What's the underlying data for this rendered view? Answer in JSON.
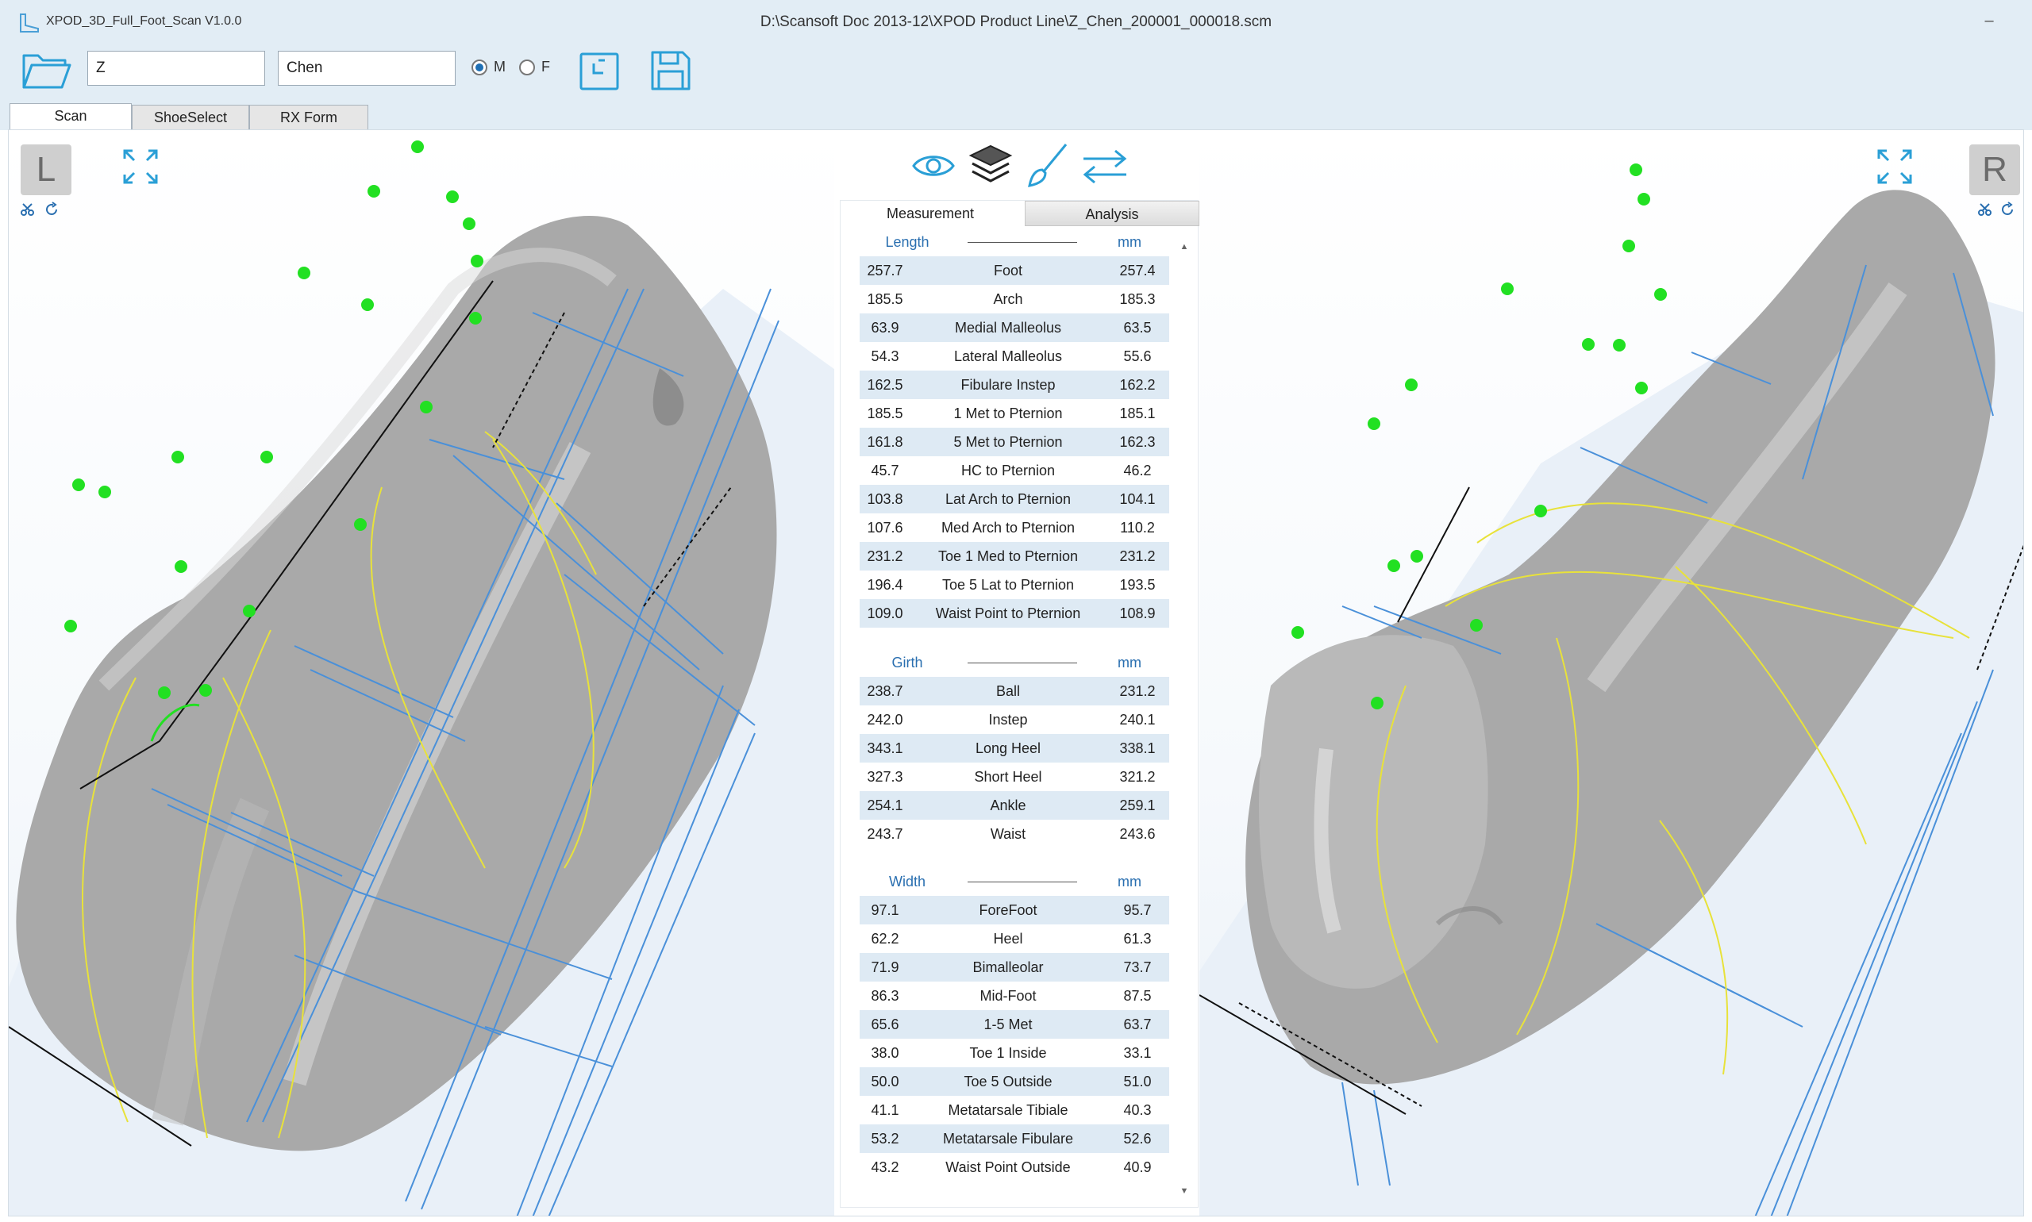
{
  "window": {
    "app_title": "XPOD_3D_Full_Foot_Scan V1.0.0",
    "file_path": "D:\\Scansoft Doc 2013-12\\XPOD Product Line\\Z_Chen_200001_000018.scm",
    "minimize": "–"
  },
  "toolbar": {
    "first_name": "Z",
    "last_name": "Chen",
    "gender_male": "M",
    "gender_female": "F",
    "selected_gender": "M"
  },
  "tabs": [
    "Scan",
    "ShoeSelect",
    "RX Form"
  ],
  "viewports": {
    "left_badge": "L",
    "right_badge": "R"
  },
  "panel": {
    "tabs": [
      "Measurement",
      "Analysis"
    ],
    "sections": [
      {
        "name": "Length",
        "unit": "mm",
        "rows": [
          {
            "left": "257.7",
            "name": "Foot",
            "right": "257.4"
          },
          {
            "left": "185.5",
            "name": "Arch",
            "right": "185.3"
          },
          {
            "left": "63.9",
            "name": "Medial Malleolus",
            "right": "63.5"
          },
          {
            "left": "54.3",
            "name": "Lateral Malleolus",
            "right": "55.6"
          },
          {
            "left": "162.5",
            "name": "Fibulare Instep",
            "right": "162.2"
          },
          {
            "left": "185.5",
            "name": "1 Met to Pternion",
            "right": "185.1"
          },
          {
            "left": "161.8",
            "name": "5 Met to Pternion",
            "right": "162.3"
          },
          {
            "left": "45.7",
            "name": "HC to Pternion",
            "right": "46.2"
          },
          {
            "left": "103.8",
            "name": "Lat Arch to Pternion",
            "right": "104.1"
          },
          {
            "left": "107.6",
            "name": "Med Arch to Pternion",
            "right": "110.2"
          },
          {
            "left": "231.2",
            "name": "Toe 1 Med to Pternion",
            "right": "231.2"
          },
          {
            "left": "196.4",
            "name": "Toe 5 Lat to Pternion",
            "right": "193.5"
          },
          {
            "left": "109.0",
            "name": "Waist Point to Pternion",
            "right": "108.9"
          }
        ]
      },
      {
        "name": "Girth",
        "unit": "mm",
        "rows": [
          {
            "left": "238.7",
            "name": "Ball",
            "right": "231.2"
          },
          {
            "left": "242.0",
            "name": "Instep",
            "right": "240.1"
          },
          {
            "left": "343.1",
            "name": "Long Heel",
            "right": "338.1"
          },
          {
            "left": "327.3",
            "name": "Short Heel",
            "right": "321.2"
          },
          {
            "left": "254.1",
            "name": "Ankle",
            "right": "259.1"
          },
          {
            "left": "243.7",
            "name": "Waist",
            "right": "243.6"
          }
        ]
      },
      {
        "name": "Width",
        "unit": "mm",
        "rows": [
          {
            "left": "97.1",
            "name": "ForeFoot",
            "right": "95.7"
          },
          {
            "left": "62.2",
            "name": "Heel",
            "right": "61.3"
          },
          {
            "left": "71.9",
            "name": "Bimalleolar",
            "right": "73.7"
          },
          {
            "left": "86.3",
            "name": "Mid-Foot",
            "right": "87.5"
          },
          {
            "left": "65.6",
            "name": "1-5 Met",
            "right": "63.7"
          },
          {
            "left": "38.0",
            "name": "Toe 1 Inside",
            "right": "33.1"
          },
          {
            "left": "50.0",
            "name": "Toe 5 Outside",
            "right": "51.0"
          },
          {
            "left": "41.1",
            "name": "Metatarsale Tibiale",
            "right": "40.3"
          },
          {
            "left": "53.2",
            "name": "Metatarsale Fibulare",
            "right": "52.6"
          },
          {
            "left": "43.2",
            "name": "Waist Point Outside",
            "right": "40.9"
          }
        ]
      }
    ]
  },
  "colors": {
    "accent": "#2a9fd6",
    "header_text": "#2a6fb0",
    "row_alt": "#deeaf4",
    "landmark": "#22e022",
    "measure_line": "#4a90d9",
    "girth_line": "#e8e23a",
    "foot_gray": "#a9a9a9"
  },
  "icons": {
    "folder": "folder-open-icon",
    "save": "save-icon",
    "report": "report-icon",
    "eye": "eye-icon",
    "layers": "layers-icon",
    "brush": "brush-icon",
    "swap": "swap-icon",
    "expand": "expand-icon",
    "scissors": "scissors-icon",
    "refresh": "refresh-icon"
  }
}
